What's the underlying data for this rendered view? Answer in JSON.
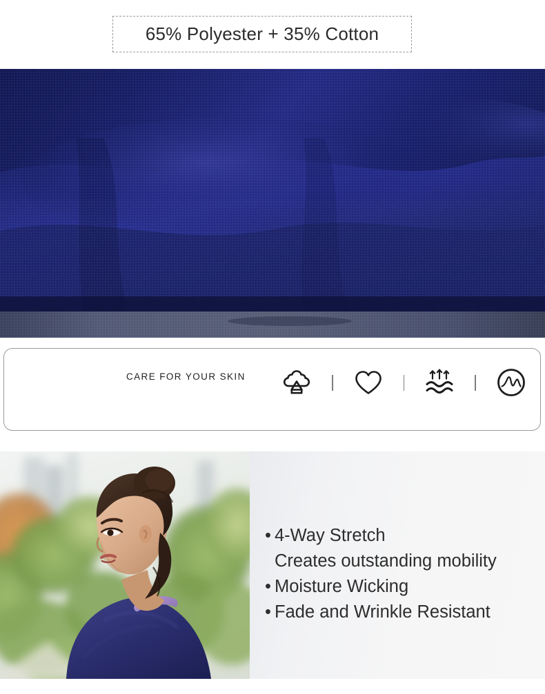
{
  "composition": {
    "text": "65% Polyester + 35% Cotton"
  },
  "hero": {
    "alt": "navy blue woven polyester cotton fabric close-up",
    "fabric_color_dark": "#141a52",
    "fabric_color_main": "#1e2572",
    "fabric_color_light": "#2b338f",
    "strip_color": "#4d5470"
  },
  "care_section": {
    "label": "CARE FOR YOUR SKIN",
    "icons": [
      {
        "name": "tree-icon",
        "meaning": "breathable"
      },
      {
        "name": "heart-icon",
        "meaning": "comfort"
      },
      {
        "name": "moisture-wicking-icon",
        "meaning": "moisture wicking"
      },
      {
        "name": "stretch-circle-icon",
        "meaning": "four way stretch"
      }
    ],
    "divider_color": "#7d7d7d",
    "border_color": "#9b9b9b"
  },
  "bottom": {
    "photo": {
      "alt": "woman in navy scrub top with lavender collar outdoors in a park",
      "scrub_color": "#2c2f70",
      "collar_color": "#9f86c0"
    },
    "features": [
      {
        "bullet": "•",
        "text": "4-Way Stretch"
      },
      {
        "bullet": "",
        "text": "Creates outstanding mobility"
      },
      {
        "bullet": "•",
        "text": "Moisture Wicking"
      },
      {
        "bullet": "•",
        "text": "Fade and Wrinkle Resistant"
      }
    ]
  }
}
